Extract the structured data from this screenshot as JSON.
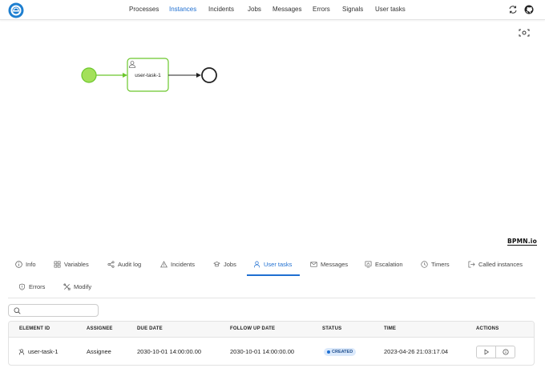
{
  "nav": {
    "items": [
      "Processes",
      "Instances",
      "Incidents",
      "Jobs",
      "Messages",
      "Errors",
      "Signals",
      "User tasks"
    ],
    "active": "Instances"
  },
  "diagram": {
    "task_label": "user-task-1",
    "watermark": "BPMN.io",
    "start_color": "#a3e05a",
    "active_color": "#6cc72c"
  },
  "tabs": [
    {
      "label": "Info",
      "icon": "info-icon"
    },
    {
      "label": "Variables",
      "icon": "variables-icon"
    },
    {
      "label": "Audit log",
      "icon": "share-icon"
    },
    {
      "label": "Incidents",
      "icon": "warning-icon"
    },
    {
      "label": "Jobs",
      "icon": "jobs-icon"
    },
    {
      "label": "User tasks",
      "icon": "user-icon",
      "active": true
    },
    {
      "label": "Messages",
      "icon": "envelope-icon"
    },
    {
      "label": "Escalation",
      "icon": "escalation-icon"
    },
    {
      "label": "Timers",
      "icon": "clock-icon"
    },
    {
      "label": "Called instances",
      "icon": "exit-icon"
    },
    {
      "label": "Errors",
      "icon": "shield-icon"
    },
    {
      "label": "Modify",
      "icon": "tools-icon"
    }
  ],
  "search": {
    "placeholder": ""
  },
  "table": {
    "headers": [
      "ELEMENT ID",
      "ASSIGNEE",
      "DUE DATE",
      "FOLLOW UP DATE",
      "STATUS",
      "TIME",
      "ACTIONS"
    ],
    "rows": [
      {
        "element_id": "user-task-1",
        "assignee": "Assignee",
        "due_date": "2030-10-01 14:00:00.00",
        "follow_up_date": "2030-10-01 14:00:00.00",
        "status": "CREATED",
        "time": "2023-04-26 21:03:17.04"
      }
    ]
  },
  "colors": {
    "accent": "#1f6fd1",
    "badge_bg": "#dbe9fb"
  }
}
